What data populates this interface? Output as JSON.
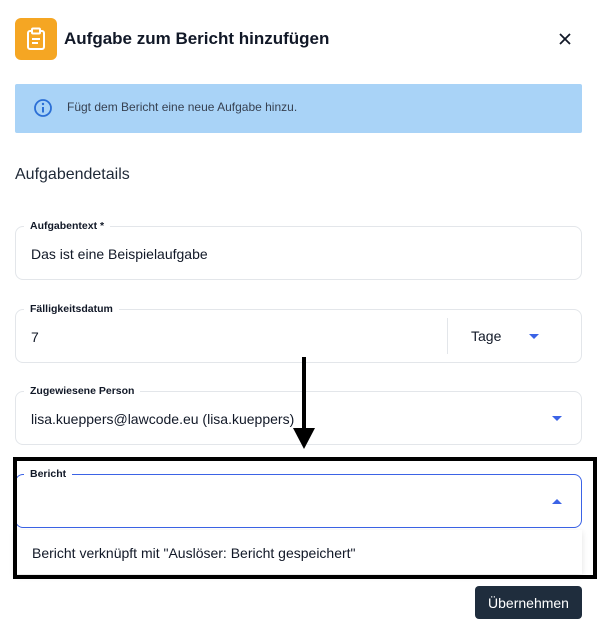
{
  "dialog": {
    "title": "Aufgabe zum Bericht hinzufügen",
    "header_icon": "clipboard-icon",
    "close_icon": "close-icon",
    "accent_color": "#f5a623"
  },
  "info": {
    "text": "Fügt dem Bericht eine neue Aufgabe hinzu.",
    "icon": "info-icon",
    "background": "#a9d3f7"
  },
  "section": {
    "title": "Aufgabendetails"
  },
  "fields": {
    "task_text": {
      "label": "Aufgabentext *",
      "value": "Das ist eine Beispielaufgabe"
    },
    "due_date": {
      "label": "Fälligkeitsdatum",
      "value": "7",
      "unit": "Tage"
    },
    "assignee": {
      "label": "Zugewiesene Person",
      "value": "lisa.kueppers@lawcode.eu (lisa.kueppers)"
    },
    "report": {
      "label": "Bericht",
      "value": ""
    }
  },
  "report_dropdown": {
    "options": [
      "Bericht verknüpft mit \"Auslöser: Bericht gespeichert\""
    ]
  },
  "actions": {
    "submit_label": "Übernehmen"
  }
}
